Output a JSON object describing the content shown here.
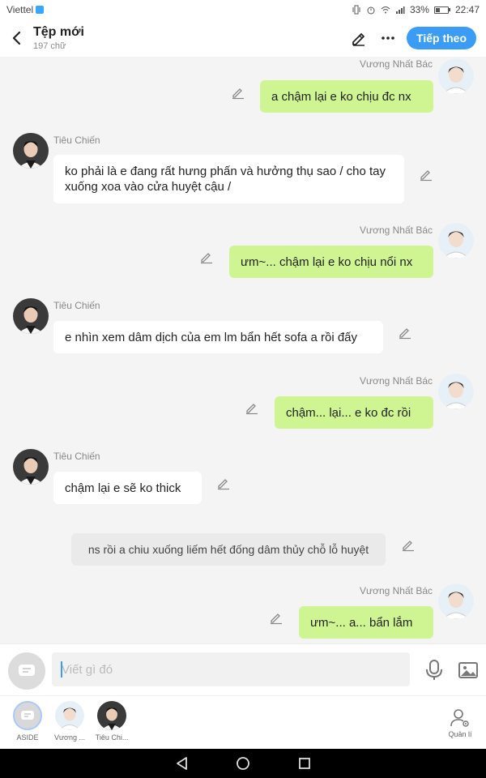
{
  "status_bar": {
    "carrier": "Viettel",
    "battery": "33%",
    "time": "22:47"
  },
  "header": {
    "title": "Tệp mới",
    "word_count": "197 chữ",
    "follow_label": "Tiếp theo",
    "accent_color": "#3b9cf6"
  },
  "messages": [
    {
      "side": "right",
      "name": "Vương Nhất Bác",
      "text": "a chậm lại e ko chịu đc nx"
    },
    {
      "side": "left",
      "name": "Tiêu Chiến",
      "text": "ko phải là e đang rất hưng phấn và hưởng thụ sao / cho tay xuống xoa vào cửa huyệt cậu /"
    },
    {
      "side": "right",
      "name": "Vương Nhất Bác",
      "text": "ưm~... chậm lại e ko chịu nổi nx"
    },
    {
      "side": "left",
      "name": "Tiêu Chiến",
      "text": "e nhìn xem dâm dịch của em lm bẩn hết sofa a rồi đấy"
    },
    {
      "side": "right",
      "name": "Vương Nhất Bác",
      "text": "chậm... lại... e ko đc rồi"
    },
    {
      "side": "left",
      "name": "Tiêu Chiến",
      "text": "chậm lại e sẽ ko thick"
    },
    {
      "side": "narration",
      "text": "ns rồi a chiu xuống liếm hết đống dâm thủy chỗ lỗ huyệt"
    },
    {
      "side": "right",
      "name": "Vương Nhất Bác",
      "text": "ưm~... a... bẩn lắm"
    }
  ],
  "input": {
    "placeholder": "Viết gì đó"
  },
  "characters": [
    {
      "label": "ASIDE"
    },
    {
      "label": "Vương ..."
    },
    {
      "label": "Tiêu Chi..."
    }
  ],
  "manage_label": "Quản lí",
  "colors": {
    "right_bubble": "#cff592",
    "left_bubble": "#ffffff",
    "narration_bubble": "#eaeaea"
  }
}
